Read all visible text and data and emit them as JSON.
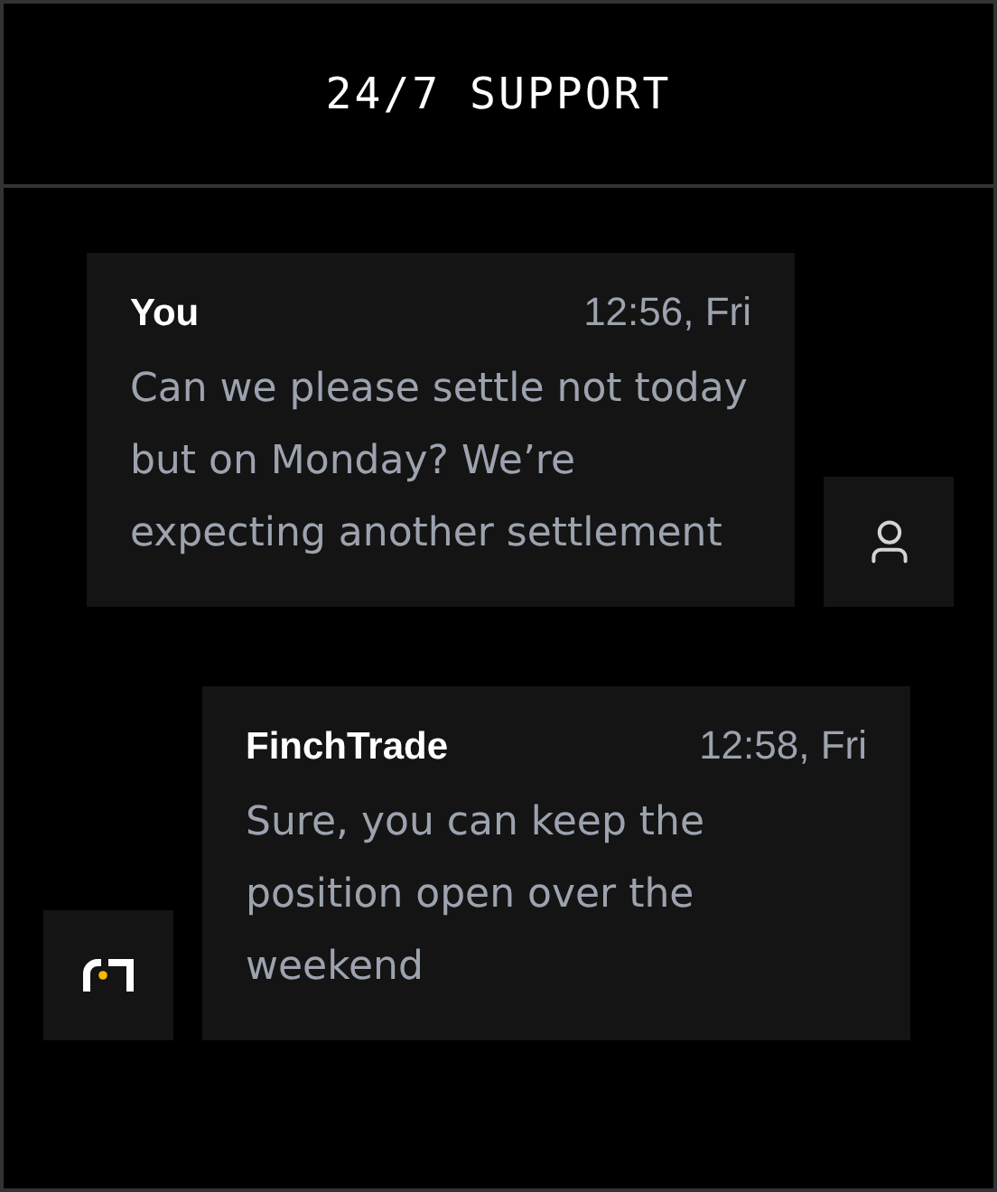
{
  "header": {
    "title": "24/7 SUPPORT"
  },
  "messages": [
    {
      "kind": "user",
      "sender": "You",
      "time": "12:56, Fri",
      "text": "Can we please settle not today but on Monday? We’re expecting another settlement"
    },
    {
      "kind": "agent",
      "sender": "FinchTrade",
      "time": "12:58, Fri",
      "text": "Sure, you can keep the position open over the weekend"
    }
  ]
}
